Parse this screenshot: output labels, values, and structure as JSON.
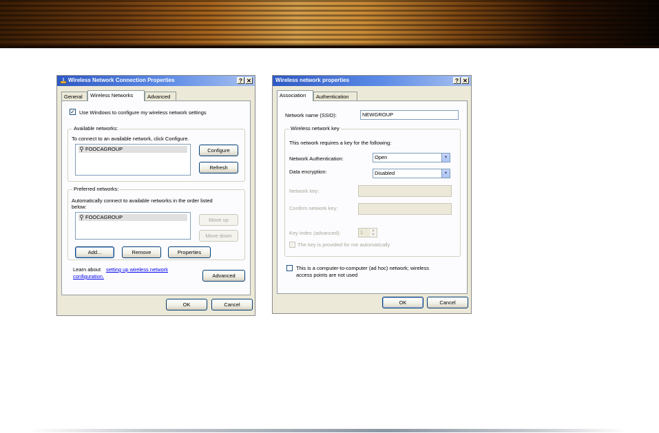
{
  "dialog1": {
    "title": "Wireless Network Connection Properties",
    "help_label": "?",
    "close_label": "✕",
    "tabs": [
      {
        "label": "General"
      },
      {
        "label": "Wireless Networks"
      },
      {
        "label": "Advanced"
      }
    ],
    "use_windows_label": "Use Windows to configure my wireless network settings",
    "available": {
      "title": "Available networks:",
      "instruction": "To connect to an available network, click Configure.",
      "items": [
        "FOOCAGROUP"
      ],
      "configure_label": "Configure",
      "refresh_label": "Refresh"
    },
    "preferred": {
      "title": "Preferred networks:",
      "instruction_line1": "Automatically connect to available networks in the order listed",
      "instruction_line2": "below:",
      "items": [
        "FOOCAGROUP"
      ],
      "move_up_label": "Move up",
      "move_down_label": "Move down",
      "add_label": "Add...",
      "remove_label": "Remove",
      "properties_label": "Properties"
    },
    "learn_about_prefix": "Learn about ",
    "learn_link_line1": "setting up wireless network",
    "learn_link_line2": "configuration.",
    "advanced_label": "Advanced",
    "ok_label": "OK",
    "cancel_label": "Cancel"
  },
  "dialog2": {
    "title": "Wireless network properties",
    "help_label": "?",
    "close_label": "✕",
    "tabs": [
      {
        "label": "Association"
      },
      {
        "label": "Authentication"
      }
    ],
    "ssid_label": "Network name (SSID):",
    "ssid_value": "NEWGROUP",
    "key_group_title": "Wireless network key",
    "key_instruction": "This network requires a key for the following:",
    "auth_label": "Network Authentication:",
    "auth_value": "Open",
    "enc_label": "Data encryption:",
    "enc_value": "Disabled",
    "netkey_label": "Network key:",
    "confirm_label": "Confirm network key:",
    "keyindex_label": "Key index (advanced):",
    "keyindex_value": "1",
    "auto_key_label": "The key is provided for me automatically",
    "adhoc_line1": "This is a computer-to-computer (ad hoc) network; wireless",
    "adhoc_line2": "access points are not used",
    "ok_label": "OK",
    "cancel_label": "Cancel"
  }
}
